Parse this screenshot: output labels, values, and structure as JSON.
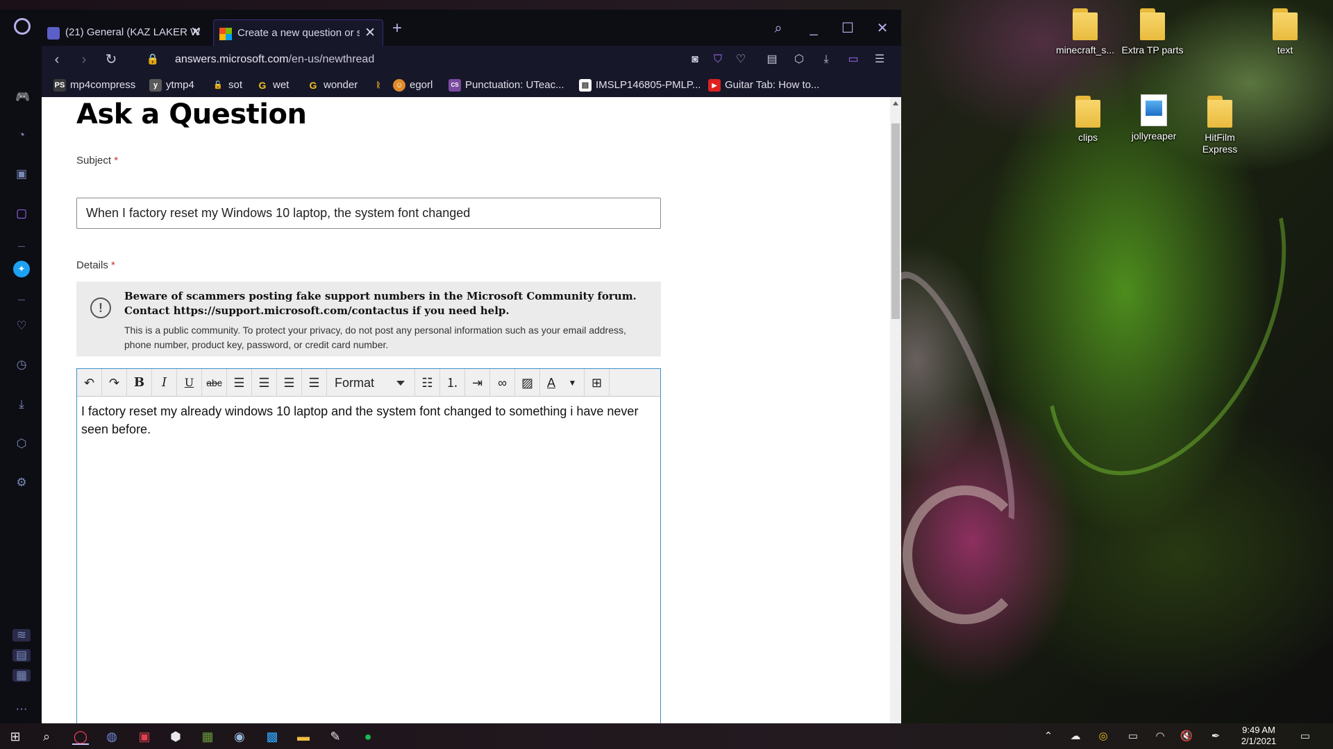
{
  "desktop": {
    "icons": [
      {
        "label": "minecraft_s..."
      },
      {
        "label": "Extra TP parts"
      },
      {
        "label": "text"
      },
      {
        "label": "clips"
      },
      {
        "label": "jollyreaper"
      },
      {
        "label": "HitFilm Express"
      }
    ]
  },
  "browser": {
    "tabs": [
      {
        "label": "(21) General (KAZ LAKER W",
        "close": "✕"
      },
      {
        "label": "Create a new question or st",
        "close": "✕"
      }
    ],
    "new_tab": "+",
    "url_host": "answers.microsoft.com",
    "url_path": "/en-us/newthread",
    "bookmarks": [
      {
        "label": "mp4compress",
        "icon": "PS",
        "color": "#3a3a3a"
      },
      {
        "label": "ytmp4",
        "icon": "y",
        "color": "#5a5a5a"
      },
      {
        "label": "sot",
        "icon": "🔓",
        "color": "transparent"
      },
      {
        "label": "wet",
        "icon": "G",
        "color": "transparent"
      },
      {
        "label": "wonder",
        "icon": "G",
        "color": "transparent"
      },
      {
        "label": "",
        "icon": "ᚱ",
        "color": "transparent"
      },
      {
        "label": "egorl",
        "icon": "☺",
        "color": "#e08a2a"
      },
      {
        "label": "Punctuation: UTeac...",
        "icon": "CS",
        "color": "#7a4aa0"
      },
      {
        "label": "IMSLP146805-PMLP...",
        "icon": "▤",
        "color": "#ffffff"
      },
      {
        "label": "Guitar Tab: How to...",
        "icon": "▶",
        "color": "#e02020"
      }
    ]
  },
  "page": {
    "title": "Ask a Question",
    "subject_label": "Subject",
    "required_mark": "*",
    "subject_value": "When I factory reset my Windows 10 laptop, the system font changed",
    "details_label": "Details",
    "warning_strong": "Beware of scammers posting fake support numbers in the Microsoft Community forum. Contact https://support.microsoft.com/contactus if you need help.",
    "warning_small": "This is a public community. To protect your privacy, do not post any personal information such as your email address, phone number, product key, password, or credit card number.",
    "warning_icon": "!",
    "format_label": "Format",
    "editor_text": "I factory reset my already windows 10 laptop and the system font changed to something i have never seen before."
  },
  "taskbar": {
    "time": "9:49 AM",
    "date": "2/1/2021"
  }
}
